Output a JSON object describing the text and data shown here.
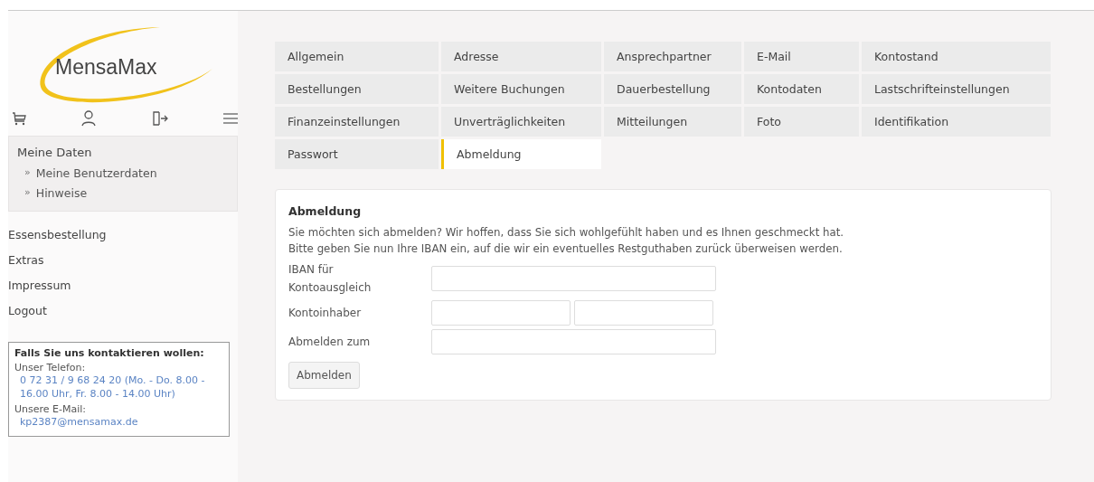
{
  "logo": {
    "text": "MensaMax"
  },
  "nav_icons": [
    {
      "kind": "cart"
    },
    {
      "kind": "user"
    },
    {
      "kind": "exit"
    },
    {
      "kind": "menu"
    }
  ],
  "sidebar": {
    "section_title": "Meine Daten",
    "sub_items": [
      {
        "marker": "»",
        "label": "Meine Benutzerdaten"
      },
      {
        "marker": "»",
        "label": "Hinweise"
      }
    ],
    "items": [
      "Essensbestellung",
      "Extras",
      "Impressum",
      "Logout"
    ],
    "contact": {
      "title": "Falls Sie uns kontaktieren wollen:",
      "entries": [
        {
          "label": "Unser Telefon:",
          "value": "0 72 31 / 9 68 24 20 (Mo. - Do. 8.00 - 16.00 Uhr, Fr. 8.00 - 14.00 Uhr)"
        },
        {
          "label": "Unsere E-Mail:",
          "value": "kp2387@mensamax.de"
        }
      ]
    }
  },
  "tabs": [
    {
      "label": "Allgemein",
      "selected": false
    },
    {
      "label": "Adresse",
      "selected": false
    },
    {
      "label": "Ansprechpartner",
      "selected": false
    },
    {
      "label": "E-Mail",
      "selected": false
    },
    {
      "label": "Kontostand",
      "selected": false
    },
    {
      "label": "Bestellungen",
      "selected": false
    },
    {
      "label": "Weitere Buchungen",
      "selected": false
    },
    {
      "label": "Dauerbestellung",
      "selected": false
    },
    {
      "label": "Kontodaten",
      "selected": false
    },
    {
      "label": "Lastschrifteinstellungen",
      "selected": false
    },
    {
      "label": "Finanzeinstellungen",
      "selected": false
    },
    {
      "label": "Unverträglichkeiten",
      "selected": false
    },
    {
      "label": "Mitteilungen",
      "selected": false
    },
    {
      "label": "Foto",
      "selected": false
    },
    {
      "label": "Identifikation",
      "selected": false
    },
    {
      "label": "Passwort",
      "selected": false
    },
    {
      "label": "Abmeldung",
      "selected": true
    }
  ],
  "form": {
    "title": "Abmeldung",
    "text": [
      "Sie möchten sich abmelden? Wir hoffen, dass Sie sich wohlgefühlt haben und es Ihnen geschmeckt hat.",
      "Bitte geben Sie nun Ihre IBAN ein, auf die wir ein eventuelles Restguthaben zurück überweisen werden."
    ],
    "fields": [
      {
        "label": "IBAN für Kontoausgleich",
        "kind": "single"
      },
      {
        "label": "Kontoinhaber",
        "kind": "double"
      },
      {
        "label": "Abmelden zum",
        "kind": "single"
      }
    ],
    "button": "Abmelden"
  }
}
